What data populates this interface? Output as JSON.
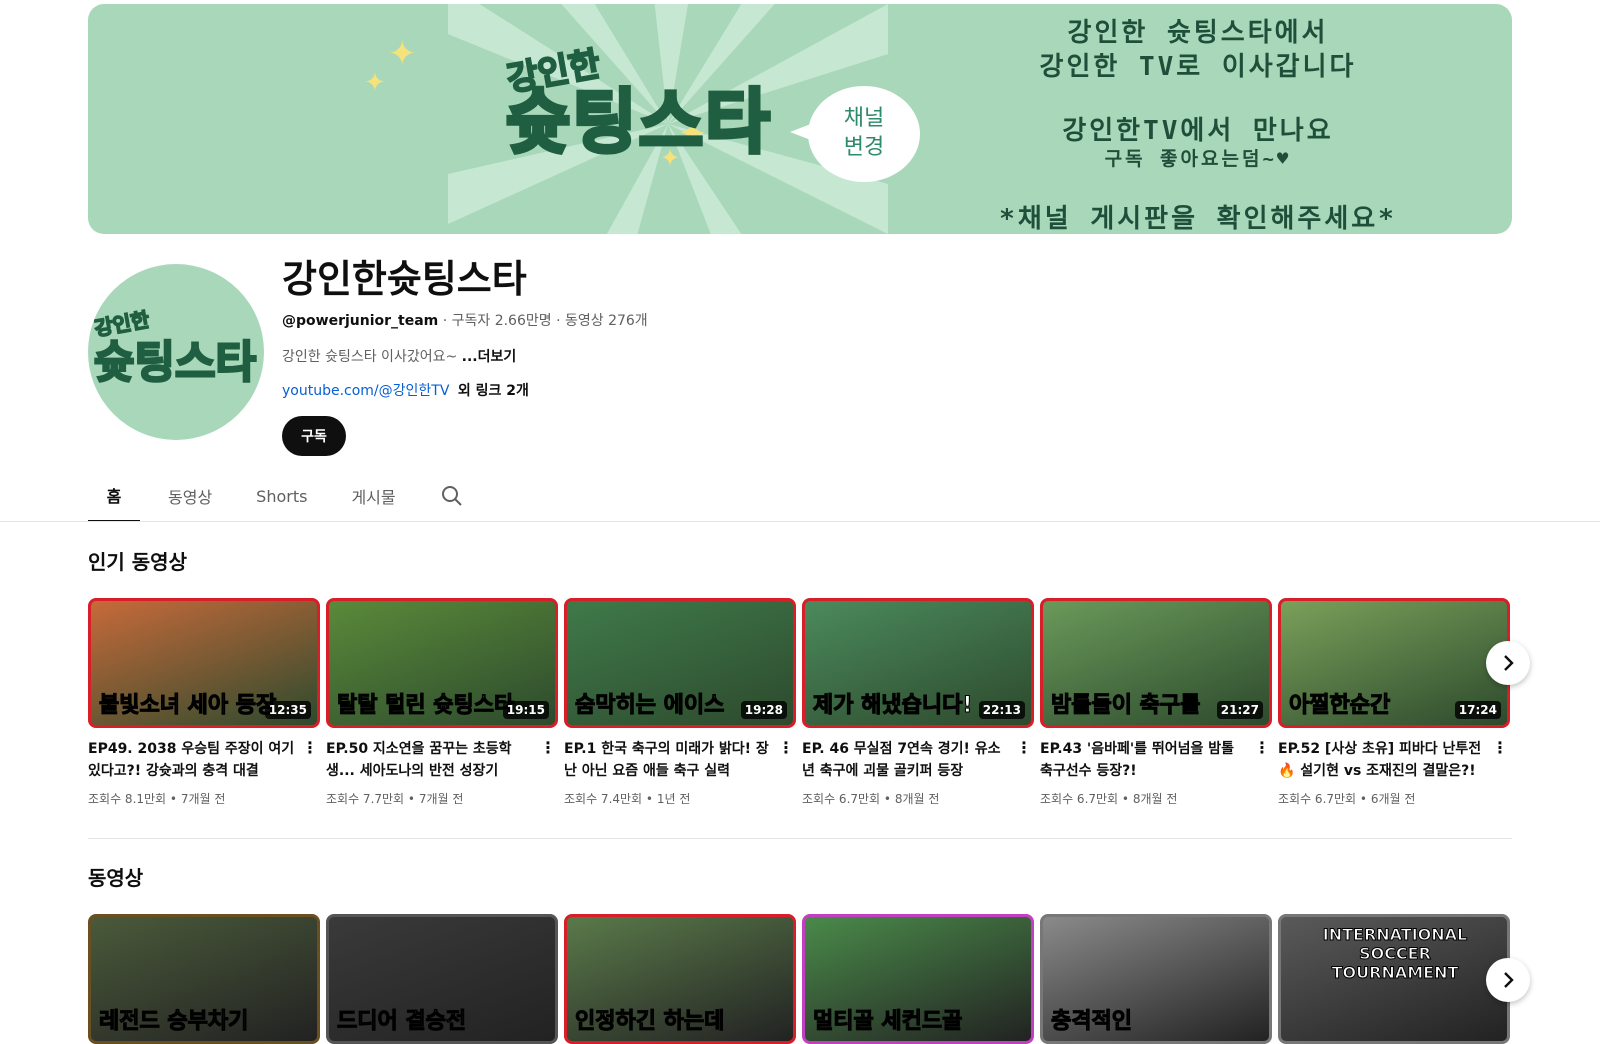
{
  "banner": {
    "logo_small": "강인한",
    "logo_big": "슛팅스타",
    "bubble_line1": "채널",
    "bubble_line2": "변경",
    "text_line1": "강인한 슛팅스타에서",
    "text_line2": "강인한 TV로 이사갑니다",
    "text_line3": "강인한TV에서 만나요",
    "text_line4": "구독 좋아요는덤~♥",
    "text_line5": "*채널 게시판을 확인해주세요*"
  },
  "channel": {
    "avatar_small": "강인한",
    "avatar_big": "슛팅스타",
    "name": "강인한슛팅스타",
    "handle": "@powerjunior_team",
    "subscribers": "구독자 2.66만명",
    "video_count": "동영상 276개",
    "description": "강인한 슛팅스타 이사갔어요~",
    "more": "...더보기",
    "link_url": "youtube.com/@강인한TV",
    "link_extra": "외 링크 2개",
    "subscribe_label": "구독"
  },
  "tabs": [
    "홈",
    "동영상",
    "Shorts",
    "게시물"
  ],
  "popular": {
    "title": "인기 동영상",
    "videos": [
      {
        "caption": "불빛소녀 세아 등장",
        "duration": "12:35",
        "title": "EP49. 2038 우승팀 주장이 여기 있다고?! 강슛과의 충격 대결",
        "views": "조회수 8.1만회",
        "age": "7개월 전",
        "color": "#c76a3a"
      },
      {
        "caption": "탈탈 털린 슛팅스타",
        "duration": "19:15",
        "title": "EP.50 지소연을 꿈꾸는 초등학생... 세아도나의 반전 성장기",
        "views": "조회수 7.7만회",
        "age": "7개월 전",
        "color": "#5a8a3a"
      },
      {
        "caption": "숨막히는 에이스",
        "duration": "19:28",
        "title": "EP.1 한국 축구의 미래가 밝다! 장난 아닌 요즘 애들 축구 실력",
        "views": "조회수 7.4만회",
        "age": "1년 전",
        "color": "#3f7a4a"
      },
      {
        "caption": "제가 해냈습니다!",
        "duration": "22:13",
        "title": "EP. 46 무실점 7연속 경기! 유소년 축구에 괴물 골키퍼 등장",
        "views": "조회수 6.7만회",
        "age": "8개월 전",
        "color": "#4b8a5c"
      },
      {
        "caption": "밤톨들이 축구를",
        "duration": "21:27",
        "title": "EP.43 '음바페'를 뛰어넘을 밤톨 축구선수 등장?!",
        "views": "조회수 6.7만회",
        "age": "8개월 전",
        "color": "#6a9a5a"
      },
      {
        "caption": "아찔한순간",
        "duration": "17:24",
        "title": "EP.52 [사상 초유] 피바다 난투전 🔥 설기현 vs 조재진의 결말은?!",
        "views": "조회수 6.7만회",
        "age": "6개월 전",
        "color": "#7aa05a"
      }
    ]
  },
  "videos_section": {
    "title": "동영상",
    "thumbs": [
      {
        "caption": "레전드 승부차기",
        "color": "#4a5a3a",
        "border": "#6a5020"
      },
      {
        "caption": "드디어 결승전",
        "color": "#3a3a3a",
        "border": "#555555"
      },
      {
        "caption": "인정하긴 하는데",
        "color": "#5a7a4a",
        "border": "#d81e28"
      },
      {
        "caption": "멀티골 세컨드골",
        "color": "#4a8a4a",
        "border": "#c040c0"
      },
      {
        "caption": "충격적인",
        "color": "#8a8a8a",
        "border": "#777777"
      },
      {
        "caption": "INTERNATIONAL SOCCER TOURNAMENT",
        "color": "#5a5a5a",
        "border": "#777777"
      }
    ]
  }
}
